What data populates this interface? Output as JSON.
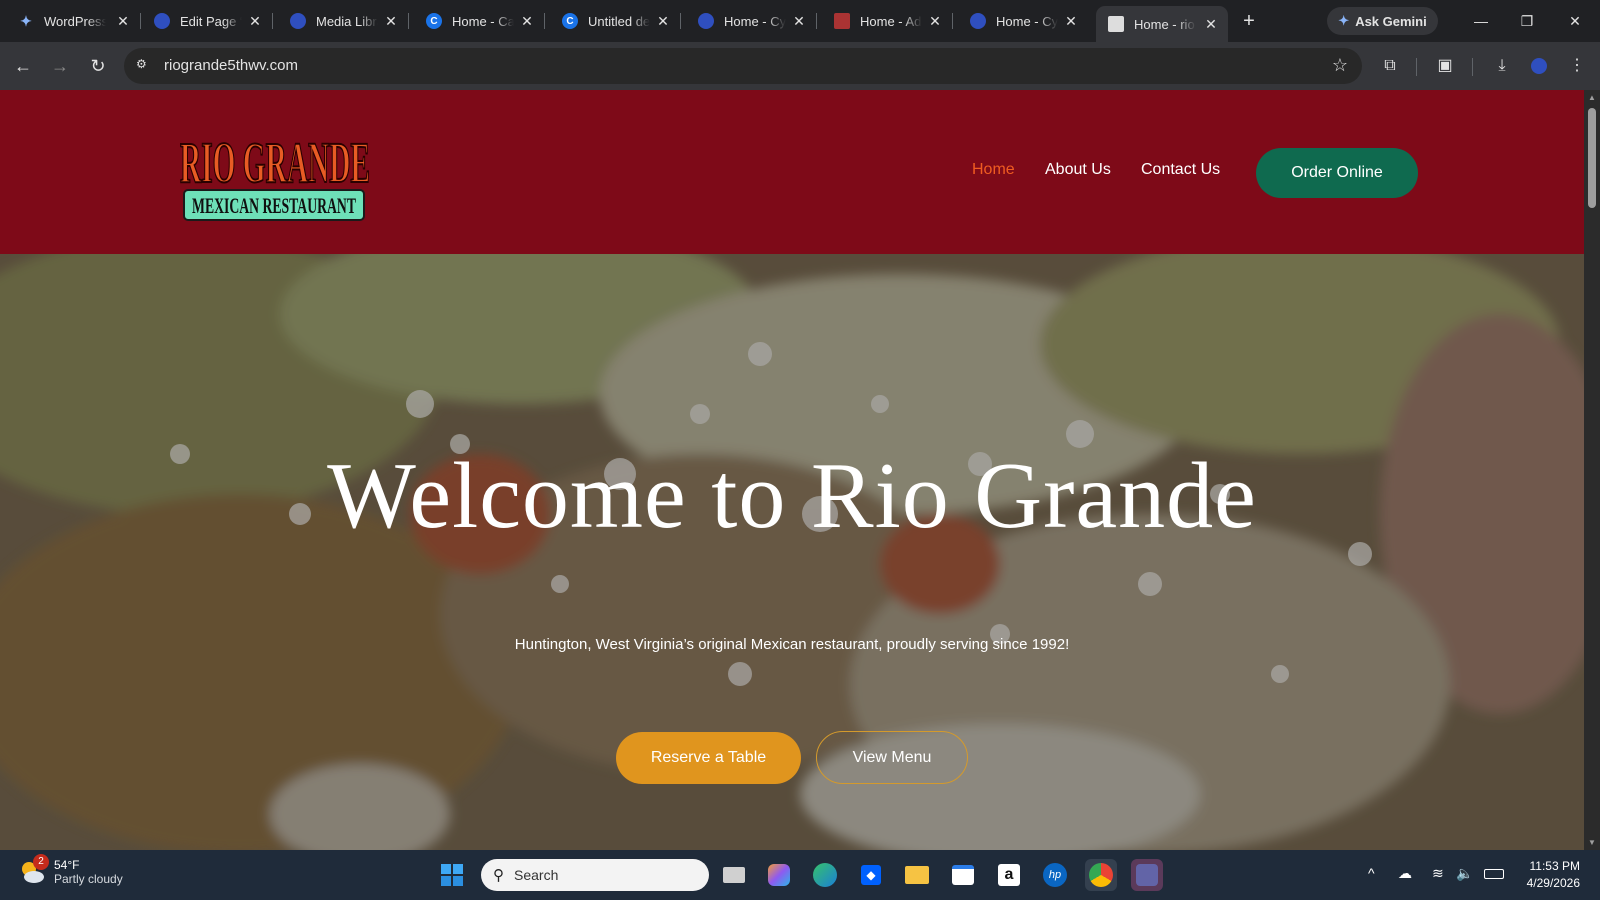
{
  "browser": {
    "tabs": [
      {
        "title": "WordPress",
        "icon": "sparkle-icon"
      },
      {
        "title": "Edit Page “",
        "icon": "globe-icon"
      },
      {
        "title": "Media Libra",
        "icon": "globe-icon"
      },
      {
        "title": "Home - Ca",
        "icon": "c-logo-icon"
      },
      {
        "title": "Untitled de",
        "icon": "c-logo-icon"
      },
      {
        "title": "Home - Cy",
        "icon": "globe-icon"
      },
      {
        "title": "Home - Ad",
        "icon": "restaurant-icon"
      },
      {
        "title": "Home - Cy",
        "icon": "globe-icon"
      },
      {
        "title": "Home - rio",
        "icon": "site-icon"
      }
    ],
    "active_tab_index": 8,
    "new_tab": "+",
    "gemini_label": "Ask Gemini",
    "url": "riogrande5thwv.com"
  },
  "site": {
    "logo": {
      "line1": "RIO GRANDE",
      "line2": "MEXICAN RESTAURANT"
    },
    "nav": [
      {
        "label": "Home",
        "current": true
      },
      {
        "label": "About Us",
        "current": false
      },
      {
        "label": "Contact Us",
        "current": false
      }
    ],
    "order_button": "Order Online",
    "hero": {
      "title": "Welcome to Rio Grande",
      "subtitle": "Huntington, West Virginia’s original Mexican restaurant, proudly serving since 1992!",
      "reserve_button": "Reserve a Table",
      "menu_button": "View Menu"
    },
    "colors": {
      "header": "#7e0a18",
      "nav_active": "#ef5c21",
      "order": "#0f6a4f",
      "reserve": "#e0951e"
    }
  },
  "taskbar": {
    "weather": {
      "temp": "54°F",
      "condition": "Partly cloudy",
      "badge": "2"
    },
    "search_label": "Search",
    "apps": [
      "windows-start-icon",
      "task-view-icon",
      "copilot-icon",
      "edge-icon",
      "dropbox-icon",
      "file-explorer-icon",
      "store-icon",
      "amazon-icon",
      "hp-icon",
      "chrome-icon",
      "teams-icon"
    ],
    "clock": {
      "time": "11:53 PM",
      "date": "4/29/2026"
    }
  }
}
